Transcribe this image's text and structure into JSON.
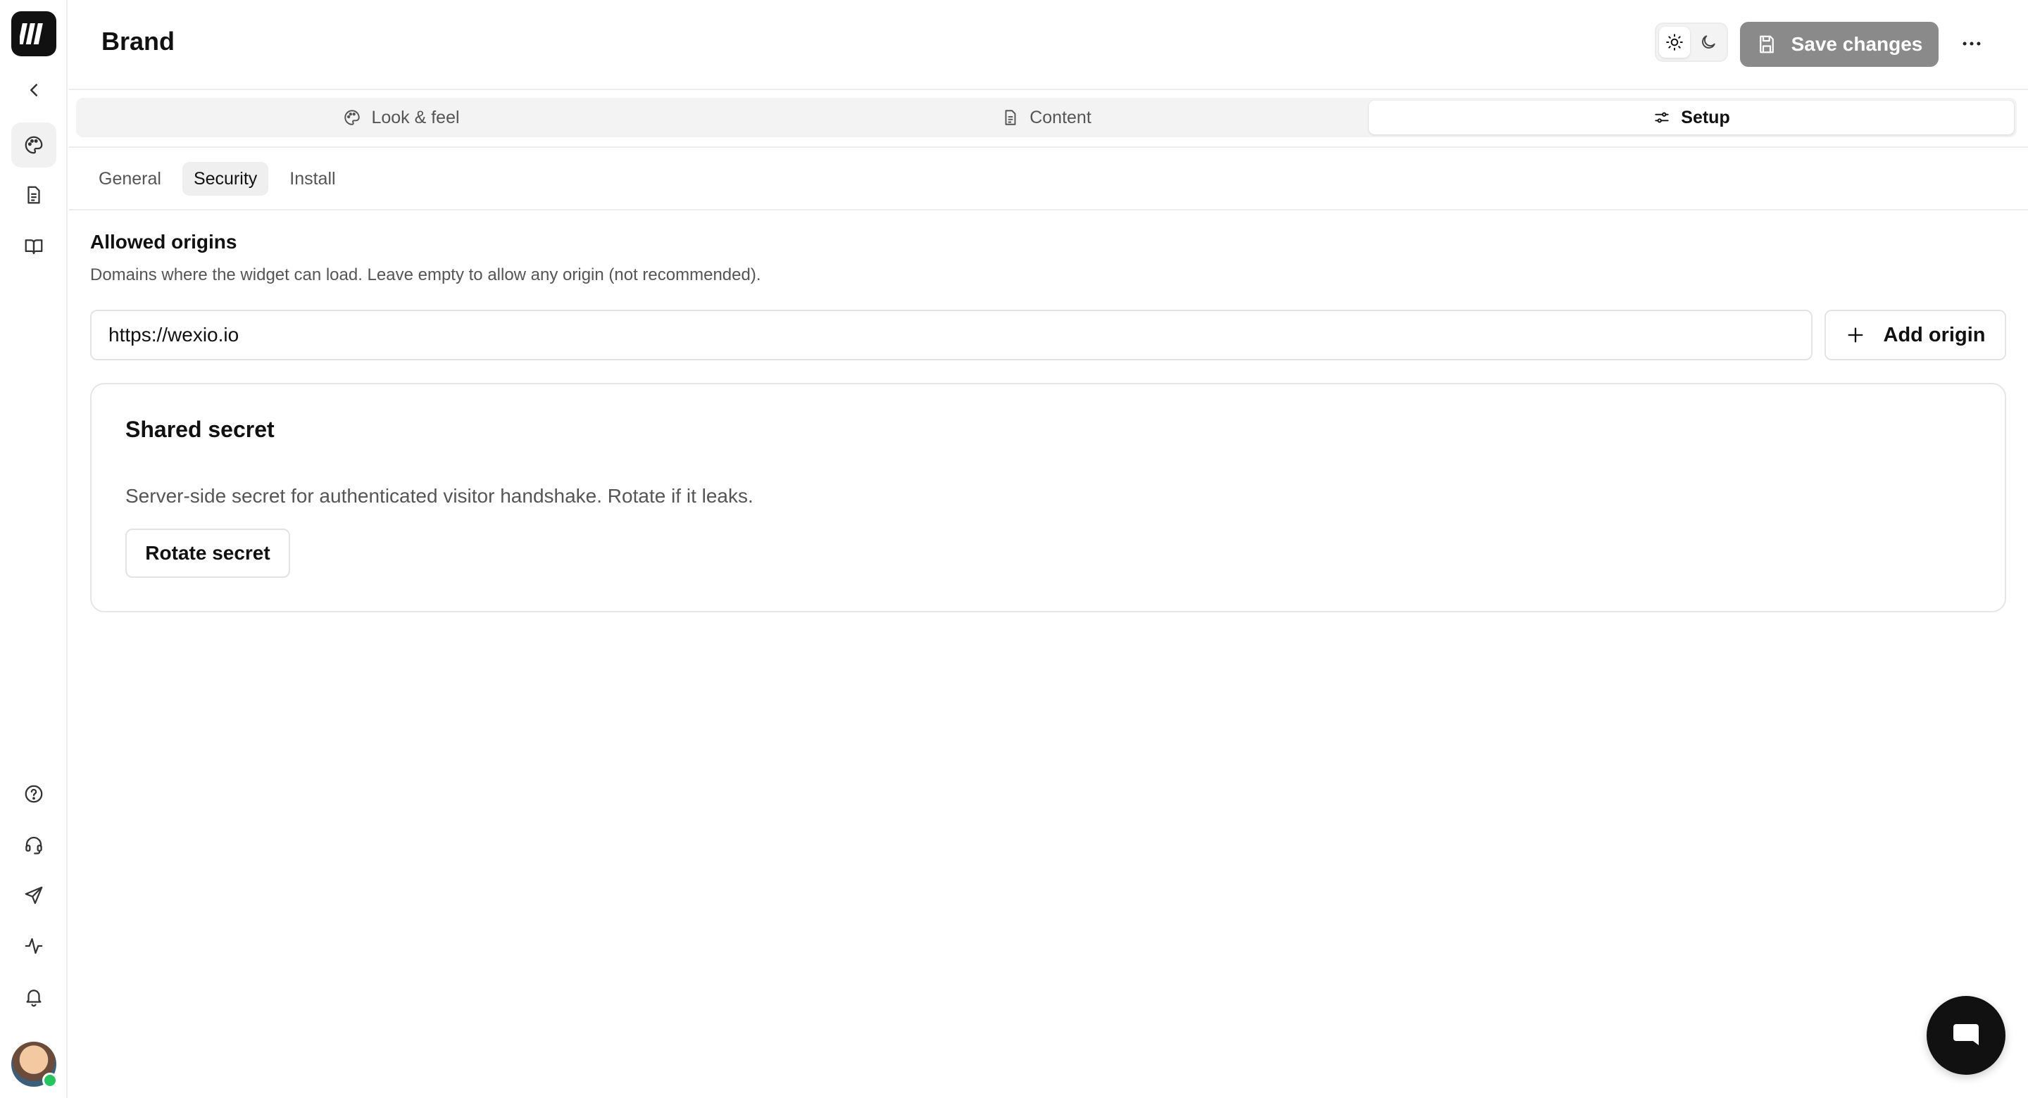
{
  "header": {
    "title": "Brand",
    "save_label": "Save changes"
  },
  "main_tabs": [
    {
      "label": "Look & feel",
      "icon": "palette-icon"
    },
    {
      "label": "Content",
      "icon": "document-icon"
    },
    {
      "label": "Setup",
      "icon": "settings-sliders-icon",
      "active": true
    }
  ],
  "sub_tabs": [
    {
      "label": "General"
    },
    {
      "label": "Security",
      "active": true
    },
    {
      "label": "Install"
    }
  ],
  "allowed_origins": {
    "title": "Allowed origins",
    "description": "Domains where the widget can load. Leave empty to allow any origin (not recommended).",
    "origin_value": "https://wexio.io",
    "add_label": "Add origin"
  },
  "shared_secret": {
    "title": "Shared secret",
    "description": "Server-side secret for authenticated visitor handshake. Rotate if it leaks.",
    "rotate_label": "Rotate secret"
  },
  "sidebar": {
    "icons": [
      "back-chevron-icon",
      "palette-icon",
      "document-icon",
      "book-icon",
      "help-icon",
      "headset-icon",
      "send-icon",
      "activity-icon",
      "bell-icon"
    ]
  },
  "colors": {
    "save_button_bg": "#8a8a8a",
    "online_status": "#22c55e",
    "brand_dark": "#111111"
  }
}
